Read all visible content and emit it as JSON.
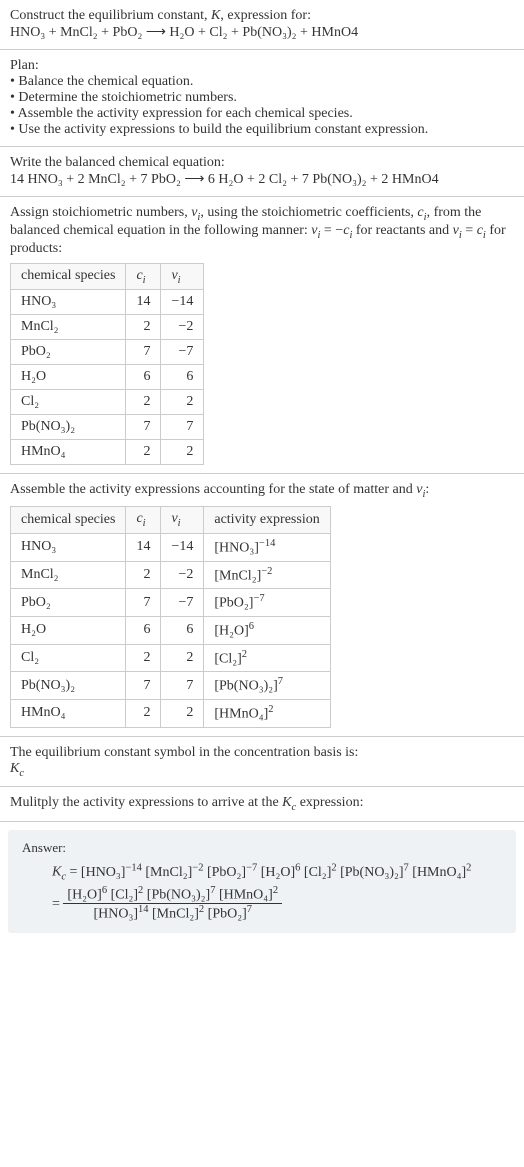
{
  "intro": {
    "line1": "Construct the equilibrium constant, ",
    "K": "K",
    "line1b": ", expression for:",
    "equation": "HNO₃ + MnCl₂ + PbO₂ ⟶ H₂O + Cl₂ + Pb(NO₃)₂ + HMnO4"
  },
  "plan": {
    "title": "Plan:",
    "items": [
      "• Balance the chemical equation.",
      "• Determine the stoichiometric numbers.",
      "• Assemble the activity expression for each chemical species.",
      "• Use the activity expressions to build the equilibrium constant expression."
    ]
  },
  "balanced": {
    "title": "Write the balanced chemical equation:",
    "equation": "14 HNO₃ + 2 MnCl₂ + 7 PbO₂ ⟶ 6 H₂O + 2 Cl₂ + 7 Pb(NO₃)₂ + 2 HMnO4"
  },
  "assign": {
    "text1": "Assign stoichiometric numbers, ",
    "nu": "ν",
    "text2": ", using the stoichiometric coefficients, ",
    "c": "c",
    "text3": ", from the balanced chemical equation in the following manner: ",
    "rel1": " = −",
    "text4": " for reactants and ",
    "rel2": " = ",
    "text5": " for products:",
    "headers": [
      "chemical species",
      "cᵢ",
      "νᵢ"
    ],
    "rows": [
      {
        "sp": "HNO₃",
        "c": "14",
        "v": "−14"
      },
      {
        "sp": "MnCl₂",
        "c": "2",
        "v": "−2"
      },
      {
        "sp": "PbO₂",
        "c": "7",
        "v": "−7"
      },
      {
        "sp": "H₂O",
        "c": "6",
        "v": "6"
      },
      {
        "sp": "Cl₂",
        "c": "2",
        "v": "2"
      },
      {
        "sp": "Pb(NO₃)₂",
        "c": "7",
        "v": "7"
      },
      {
        "sp": "HMnO₄",
        "c": "2",
        "v": "2"
      }
    ]
  },
  "activity": {
    "title": "Assemble the activity expressions accounting for the state of matter and νᵢ:",
    "headers": [
      "chemical species",
      "cᵢ",
      "νᵢ",
      "activity expression"
    ],
    "rows": [
      {
        "sp": "HNO₃",
        "c": "14",
        "v": "−14",
        "a_base": "[HNO₃]",
        "a_exp": "−14"
      },
      {
        "sp": "MnCl₂",
        "c": "2",
        "v": "−2",
        "a_base": "[MnCl₂]",
        "a_exp": "−2"
      },
      {
        "sp": "PbO₂",
        "c": "7",
        "v": "−7",
        "a_base": "[PbO₂]",
        "a_exp": "−7"
      },
      {
        "sp": "H₂O",
        "c": "6",
        "v": "6",
        "a_base": "[H₂O]",
        "a_exp": "6"
      },
      {
        "sp": "Cl₂",
        "c": "2",
        "v": "2",
        "a_base": "[Cl₂]",
        "a_exp": "2"
      },
      {
        "sp": "Pb(NO₃)₂",
        "c": "7",
        "v": "7",
        "a_base": "[Pb(NO₃)₂]",
        "a_exp": "7"
      },
      {
        "sp": "HMnO₄",
        "c": "2",
        "v": "2",
        "a_base": "[HMnO₄]",
        "a_exp": "2"
      }
    ]
  },
  "symbol": {
    "title": "The equilibrium constant symbol in the concentration basis is:",
    "Kc_K": "K",
    "Kc_c": "c"
  },
  "multiply": {
    "title": "Mulitply the activity expressions to arrive at the ",
    "Kc_K": "K",
    "Kc_c": "c",
    "title2": " expression:"
  },
  "answer": {
    "label": "Answer:",
    "Kc_K": "K",
    "Kc_c": "c",
    "eq": " = ",
    "line1_terms": [
      {
        "b": "[HNO₃]",
        "e": "−14"
      },
      {
        "b": "[MnCl₂]",
        "e": "−2"
      },
      {
        "b": "[PbO₂]",
        "e": "−7"
      },
      {
        "b": "[H₂O]",
        "e": "6"
      },
      {
        "b": "[Cl₂]",
        "e": "2"
      },
      {
        "b": "[Pb(NO₃)₂]",
        "e": "7"
      },
      {
        "b": "[HMnO₄]",
        "e": "2"
      }
    ],
    "eq2": "= ",
    "num_terms": [
      {
        "b": "[H₂O]",
        "e": "6"
      },
      {
        "b": "[Cl₂]",
        "e": "2"
      },
      {
        "b": "[Pb(NO₃)₂]",
        "e": "7"
      },
      {
        "b": "[HMnO₄]",
        "e": "2"
      }
    ],
    "den_terms": [
      {
        "b": "[HNO₃]",
        "e": "14"
      },
      {
        "b": "[MnCl₂]",
        "e": "2"
      },
      {
        "b": "[PbO₂]",
        "e": "7"
      }
    ]
  },
  "chart_data": {
    "type": "table",
    "tables": [
      {
        "title": "Stoichiometric numbers",
        "columns": [
          "chemical species",
          "c_i",
          "nu_i"
        ],
        "rows": [
          [
            "HNO3",
            14,
            -14
          ],
          [
            "MnCl2",
            2,
            -2
          ],
          [
            "PbO2",
            7,
            -7
          ],
          [
            "H2O",
            6,
            6
          ],
          [
            "Cl2",
            2,
            2
          ],
          [
            "Pb(NO3)2",
            7,
            7
          ],
          [
            "HMnO4",
            2,
            2
          ]
        ]
      },
      {
        "title": "Activity expressions",
        "columns": [
          "chemical species",
          "c_i",
          "nu_i",
          "activity expression"
        ],
        "rows": [
          [
            "HNO3",
            14,
            -14,
            "[HNO3]^-14"
          ],
          [
            "MnCl2",
            2,
            -2,
            "[MnCl2]^-2"
          ],
          [
            "PbO2",
            7,
            -7,
            "[PbO2]^-7"
          ],
          [
            "H2O",
            6,
            6,
            "[H2O]^6"
          ],
          [
            "Cl2",
            2,
            2,
            "[Cl2]^2"
          ],
          [
            "Pb(NO3)2",
            7,
            7,
            "[Pb(NO3)2]^7"
          ],
          [
            "HMnO4",
            2,
            2,
            "[HMnO4]^2"
          ]
        ]
      }
    ]
  }
}
